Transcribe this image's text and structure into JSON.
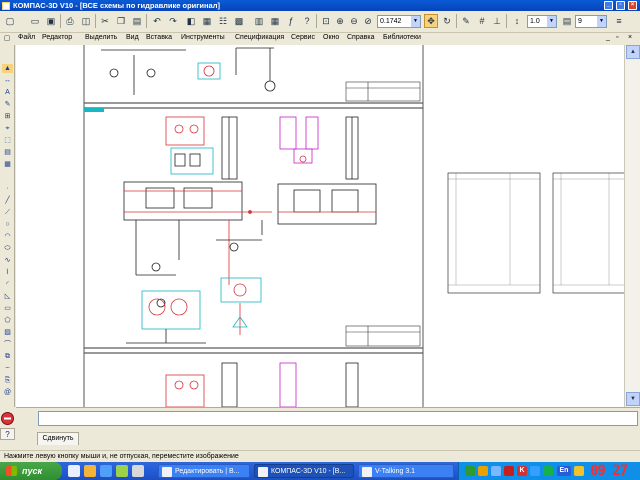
{
  "window": {
    "title": "КОМПАС-3D V10 - [ВСЕ схемы по гидравлике оригинал]",
    "controls": [
      "minimize",
      "restore",
      "close"
    ]
  },
  "toolbar": {
    "icons": [
      "new-document-icon",
      "open-icon",
      "save-icon",
      "print-icon",
      "preview-icon",
      "cut-icon",
      "copy-icon",
      "paste-icon",
      "undo-icon",
      "redo-icon",
      "zoom-in-icon",
      "zoom-out-icon",
      "zoom-window-icon",
      "zoom-scale-icon",
      "pan-icon",
      "refresh-icon",
      "snap-icon",
      "grid-icon",
      "ortho-icon"
    ],
    "zoom_value": "0.1742",
    "step_value": "1.0",
    "layer_value": "9"
  },
  "menu": {
    "items": [
      "Файл",
      "Редактор",
      "Выделить",
      "Вид",
      "Вставка",
      "Инструменты",
      "Спецификация",
      "Сервис",
      "Окно",
      "Справка",
      "Библиотеки"
    ]
  },
  "property_panel": {
    "tab_label": "Сдвинуть"
  },
  "status": {
    "text": "Нажмите левую кнопку мыши и, не отпуская, переместите изображение"
  },
  "taskbar": {
    "start_label": "пуск",
    "tasks": [
      {
        "label": "Редактировать | В...",
        "active": false
      },
      {
        "label": "КОМПАС-3D V10 - [В...",
        "active": true
      },
      {
        "label": "V-Talking 3.1",
        "active": false
      }
    ],
    "tray_lang": "En",
    "clock": "09 27"
  },
  "colors": {
    "titlebar": "#0a5bd6",
    "taskbar": "#245edc",
    "start": "#3c9a3c",
    "clock": "#ff2a2a",
    "drawing_red": "#d8323a",
    "drawing_cyan": "#17b8c4",
    "drawing_magenta": "#c61fc6"
  }
}
